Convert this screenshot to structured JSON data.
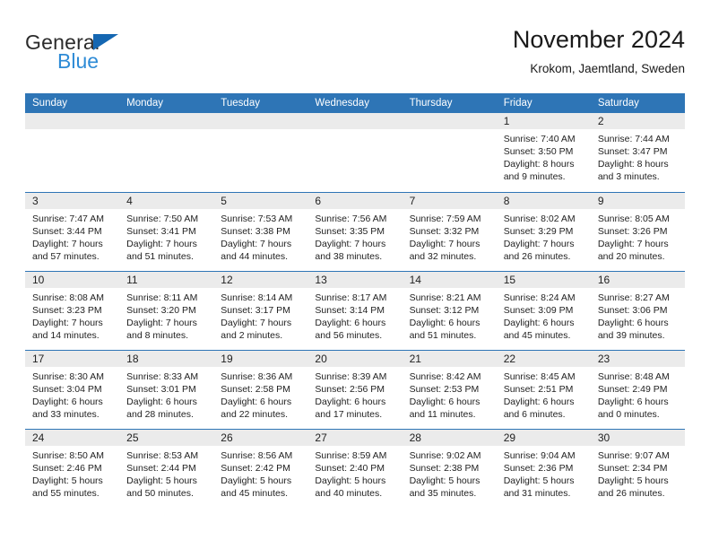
{
  "brand": {
    "line1": "General",
    "line2": "Blue",
    "triangle_color": "#1567b2",
    "blue_text_color": "#2e8bd6"
  },
  "header": {
    "title": "November 2024",
    "subtitle": "Krokom, Jaemtland, Sweden"
  },
  "theme": {
    "header_blue": "#2e75b6",
    "day_band_gray": "#ebebeb",
    "row_divider": "#2e75b6"
  },
  "weekdays": [
    "Sunday",
    "Monday",
    "Tuesday",
    "Wednesday",
    "Thursday",
    "Friday",
    "Saturday"
  ],
  "weeks": [
    [
      {
        "day": "",
        "lines": []
      },
      {
        "day": "",
        "lines": []
      },
      {
        "day": "",
        "lines": []
      },
      {
        "day": "",
        "lines": []
      },
      {
        "day": "",
        "lines": []
      },
      {
        "day": "1",
        "lines": [
          "Sunrise: 7:40 AM",
          "Sunset: 3:50 PM",
          "Daylight: 8 hours",
          "and 9 minutes."
        ]
      },
      {
        "day": "2",
        "lines": [
          "Sunrise: 7:44 AM",
          "Sunset: 3:47 PM",
          "Daylight: 8 hours",
          "and 3 minutes."
        ]
      }
    ],
    [
      {
        "day": "3",
        "lines": [
          "Sunrise: 7:47 AM",
          "Sunset: 3:44 PM",
          "Daylight: 7 hours",
          "and 57 minutes."
        ]
      },
      {
        "day": "4",
        "lines": [
          "Sunrise: 7:50 AM",
          "Sunset: 3:41 PM",
          "Daylight: 7 hours",
          "and 51 minutes."
        ]
      },
      {
        "day": "5",
        "lines": [
          "Sunrise: 7:53 AM",
          "Sunset: 3:38 PM",
          "Daylight: 7 hours",
          "and 44 minutes."
        ]
      },
      {
        "day": "6",
        "lines": [
          "Sunrise: 7:56 AM",
          "Sunset: 3:35 PM",
          "Daylight: 7 hours",
          "and 38 minutes."
        ]
      },
      {
        "day": "7",
        "lines": [
          "Sunrise: 7:59 AM",
          "Sunset: 3:32 PM",
          "Daylight: 7 hours",
          "and 32 minutes."
        ]
      },
      {
        "day": "8",
        "lines": [
          "Sunrise: 8:02 AM",
          "Sunset: 3:29 PM",
          "Daylight: 7 hours",
          "and 26 minutes."
        ]
      },
      {
        "day": "9",
        "lines": [
          "Sunrise: 8:05 AM",
          "Sunset: 3:26 PM",
          "Daylight: 7 hours",
          "and 20 minutes."
        ]
      }
    ],
    [
      {
        "day": "10",
        "lines": [
          "Sunrise: 8:08 AM",
          "Sunset: 3:23 PM",
          "Daylight: 7 hours",
          "and 14 minutes."
        ]
      },
      {
        "day": "11",
        "lines": [
          "Sunrise: 8:11 AM",
          "Sunset: 3:20 PM",
          "Daylight: 7 hours",
          "and 8 minutes."
        ]
      },
      {
        "day": "12",
        "lines": [
          "Sunrise: 8:14 AM",
          "Sunset: 3:17 PM",
          "Daylight: 7 hours",
          "and 2 minutes."
        ]
      },
      {
        "day": "13",
        "lines": [
          "Sunrise: 8:17 AM",
          "Sunset: 3:14 PM",
          "Daylight: 6 hours",
          "and 56 minutes."
        ]
      },
      {
        "day": "14",
        "lines": [
          "Sunrise: 8:21 AM",
          "Sunset: 3:12 PM",
          "Daylight: 6 hours",
          "and 51 minutes."
        ]
      },
      {
        "day": "15",
        "lines": [
          "Sunrise: 8:24 AM",
          "Sunset: 3:09 PM",
          "Daylight: 6 hours",
          "and 45 minutes."
        ]
      },
      {
        "day": "16",
        "lines": [
          "Sunrise: 8:27 AM",
          "Sunset: 3:06 PM",
          "Daylight: 6 hours",
          "and 39 minutes."
        ]
      }
    ],
    [
      {
        "day": "17",
        "lines": [
          "Sunrise: 8:30 AM",
          "Sunset: 3:04 PM",
          "Daylight: 6 hours",
          "and 33 minutes."
        ]
      },
      {
        "day": "18",
        "lines": [
          "Sunrise: 8:33 AM",
          "Sunset: 3:01 PM",
          "Daylight: 6 hours",
          "and 28 minutes."
        ]
      },
      {
        "day": "19",
        "lines": [
          "Sunrise: 8:36 AM",
          "Sunset: 2:58 PM",
          "Daylight: 6 hours",
          "and 22 minutes."
        ]
      },
      {
        "day": "20",
        "lines": [
          "Sunrise: 8:39 AM",
          "Sunset: 2:56 PM",
          "Daylight: 6 hours",
          "and 17 minutes."
        ]
      },
      {
        "day": "21",
        "lines": [
          "Sunrise: 8:42 AM",
          "Sunset: 2:53 PM",
          "Daylight: 6 hours",
          "and 11 minutes."
        ]
      },
      {
        "day": "22",
        "lines": [
          "Sunrise: 8:45 AM",
          "Sunset: 2:51 PM",
          "Daylight: 6 hours",
          "and 6 minutes."
        ]
      },
      {
        "day": "23",
        "lines": [
          "Sunrise: 8:48 AM",
          "Sunset: 2:49 PM",
          "Daylight: 6 hours",
          "and 0 minutes."
        ]
      }
    ],
    [
      {
        "day": "24",
        "lines": [
          "Sunrise: 8:50 AM",
          "Sunset: 2:46 PM",
          "Daylight: 5 hours",
          "and 55 minutes."
        ]
      },
      {
        "day": "25",
        "lines": [
          "Sunrise: 8:53 AM",
          "Sunset: 2:44 PM",
          "Daylight: 5 hours",
          "and 50 minutes."
        ]
      },
      {
        "day": "26",
        "lines": [
          "Sunrise: 8:56 AM",
          "Sunset: 2:42 PM",
          "Daylight: 5 hours",
          "and 45 minutes."
        ]
      },
      {
        "day": "27",
        "lines": [
          "Sunrise: 8:59 AM",
          "Sunset: 2:40 PM",
          "Daylight: 5 hours",
          "and 40 minutes."
        ]
      },
      {
        "day": "28",
        "lines": [
          "Sunrise: 9:02 AM",
          "Sunset: 2:38 PM",
          "Daylight: 5 hours",
          "and 35 minutes."
        ]
      },
      {
        "day": "29",
        "lines": [
          "Sunrise: 9:04 AM",
          "Sunset: 2:36 PM",
          "Daylight: 5 hours",
          "and 31 minutes."
        ]
      },
      {
        "day": "30",
        "lines": [
          "Sunrise: 9:07 AM",
          "Sunset: 2:34 PM",
          "Daylight: 5 hours",
          "and 26 minutes."
        ]
      }
    ]
  ]
}
